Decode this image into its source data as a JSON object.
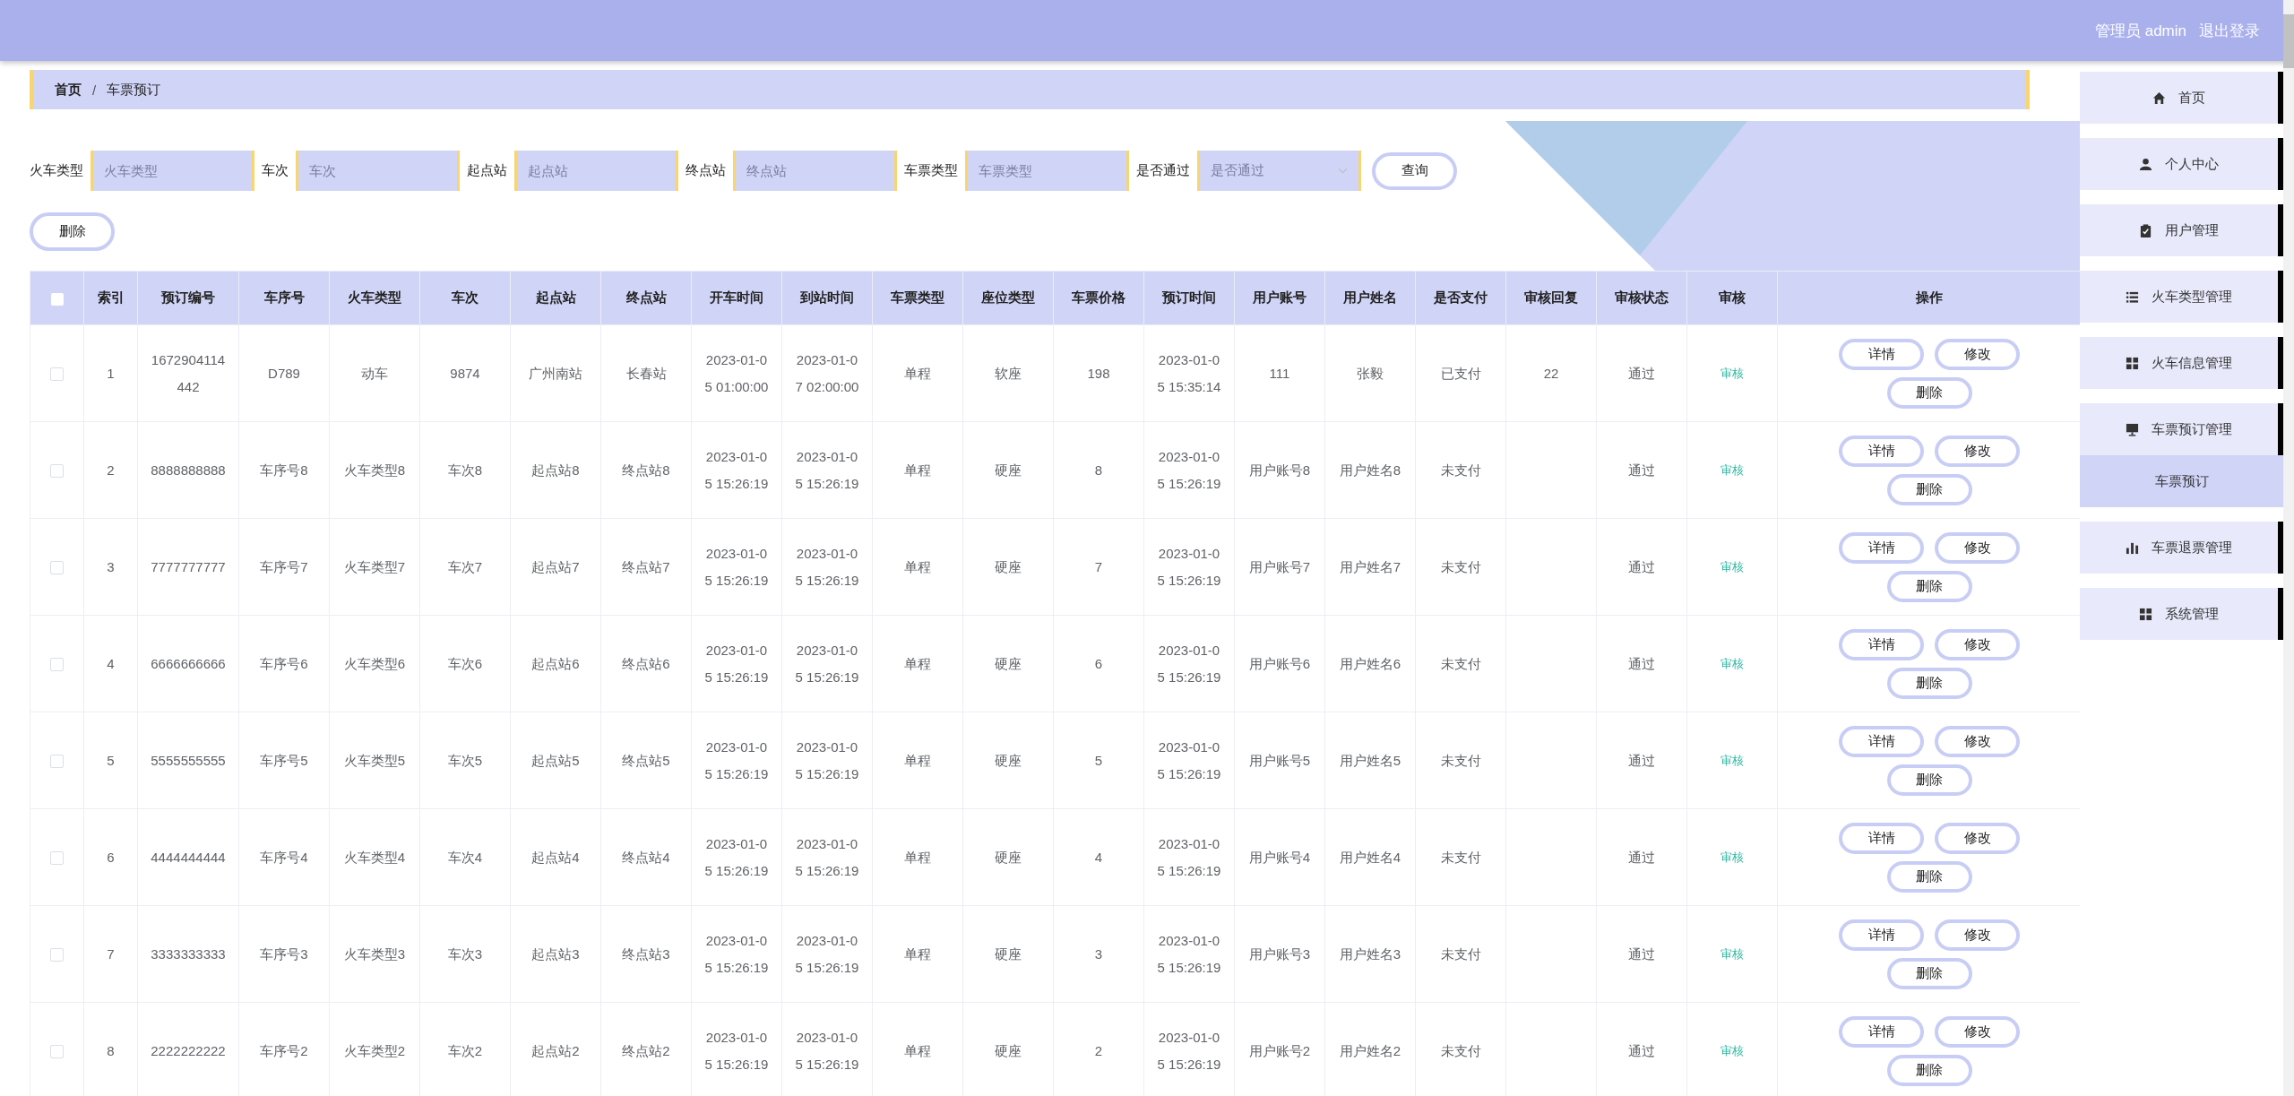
{
  "header": {
    "role": "管理员",
    "user": "admin",
    "logout": "退出登录"
  },
  "breadcrumb": [
    {
      "label": "首页",
      "current": false
    },
    {
      "separator": "/",
      "label": "车票预订",
      "current": true
    }
  ],
  "filters": [
    {
      "kind": "input",
      "label": "火车类型",
      "placeholder": "火车类型"
    },
    {
      "kind": "input",
      "label": "车次",
      "placeholder": "车次"
    },
    {
      "kind": "input",
      "label": "起点站",
      "placeholder": "起点站"
    },
    {
      "kind": "input",
      "label": "终点站",
      "placeholder": "终点站"
    },
    {
      "kind": "input",
      "label": "车票类型",
      "placeholder": "车票类型"
    },
    {
      "kind": "select",
      "label": "是否通过",
      "placeholder": "是否通过"
    }
  ],
  "search_button": "查询",
  "delete_button": "删除",
  "table": {
    "all_checked": false,
    "columns": [
      "索引",
      "预订编号",
      "车序号",
      "火车类型",
      "车次",
      "起点站",
      "终点站",
      "开车时间",
      "到站时间",
      "车票类型",
      "座位类型",
      "车票价格",
      "预订时间",
      "用户账号",
      "用户姓名",
      "是否支付",
      "审核回复",
      "审核状态",
      "审核",
      "操作"
    ],
    "rows": [
      {
        "checked": false,
        "cells": [
          "1",
          "1672904114442",
          "D789",
          "动车",
          "9874",
          "广州南站",
          "长春站",
          "2023-01-05 01:00:00",
          "2023-01-07 02:00:00",
          "单程",
          "软座",
          "198",
          "2023-01-05 15:35:14",
          "111",
          "张毅",
          "已支付",
          "22",
          "通过"
        ],
        "audit": "审核",
        "actions": [
          "详情",
          "修改",
          "删除"
        ]
      },
      {
        "checked": false,
        "cells": [
          "2",
          "8888888888",
          "车序号8",
          "火车类型8",
          "车次8",
          "起点站8",
          "终点站8",
          "2023-01-05 15:26:19",
          "2023-01-05 15:26:19",
          "单程",
          "硬座",
          "8",
          "2023-01-05 15:26:19",
          "用户账号8",
          "用户姓名8",
          "未支付",
          null,
          "通过"
        ],
        "audit": "审核",
        "actions": [
          "详情",
          "修改",
          "删除"
        ]
      },
      {
        "checked": false,
        "cells": [
          "3",
          "7777777777",
          "车序号7",
          "火车类型7",
          "车次7",
          "起点站7",
          "终点站7",
          "2023-01-05 15:26:19",
          "2023-01-05 15:26:19",
          "单程",
          "硬座",
          "7",
          "2023-01-05 15:26:19",
          "用户账号7",
          "用户姓名7",
          "未支付",
          null,
          "通过"
        ],
        "audit": "审核",
        "actions": [
          "详情",
          "修改",
          "删除"
        ]
      },
      {
        "checked": false,
        "cells": [
          "4",
          "6666666666",
          "车序号6",
          "火车类型6",
          "车次6",
          "起点站6",
          "终点站6",
          "2023-01-05 15:26:19",
          "2023-01-05 15:26:19",
          "单程",
          "硬座",
          "6",
          "2023-01-05 15:26:19",
          "用户账号6",
          "用户姓名6",
          "未支付",
          null,
          "通过"
        ],
        "audit": "审核",
        "actions": [
          "详情",
          "修改",
          "删除"
        ]
      },
      {
        "checked": false,
        "cells": [
          "5",
          "5555555555",
          "车序号5",
          "火车类型5",
          "车次5",
          "起点站5",
          "终点站5",
          "2023-01-05 15:26:19",
          "2023-01-05 15:26:19",
          "单程",
          "硬座",
          "5",
          "2023-01-05 15:26:19",
          "用户账号5",
          "用户姓名5",
          "未支付",
          null,
          "通过"
        ],
        "audit": "审核",
        "actions": [
          "详情",
          "修改",
          "删除"
        ]
      },
      {
        "checked": false,
        "cells": [
          "6",
          "4444444444",
          "车序号4",
          "火车类型4",
          "车次4",
          "起点站4",
          "终点站4",
          "2023-01-05 15:26:19",
          "2023-01-05 15:26:19",
          "单程",
          "硬座",
          "4",
          "2023-01-05 15:26:19",
          "用户账号4",
          "用户姓名4",
          "未支付",
          null,
          "通过"
        ],
        "audit": "审核",
        "actions": [
          "详情",
          "修改",
          "删除"
        ]
      },
      {
        "checked": false,
        "cells": [
          "7",
          "3333333333",
          "车序号3",
          "火车类型3",
          "车次3",
          "起点站3",
          "终点站3",
          "2023-01-05 15:26:19",
          "2023-01-05 15:26:19",
          "单程",
          "硬座",
          "3",
          "2023-01-05 15:26:19",
          "用户账号3",
          "用户姓名3",
          "未支付",
          null,
          "通过"
        ],
        "audit": "审核",
        "actions": [
          "详情",
          "修改",
          "删除"
        ]
      },
      {
        "checked": false,
        "cells": [
          "8",
          "2222222222",
          "车序号2",
          "火车类型2",
          "车次2",
          "起点站2",
          "终点站2",
          "2023-01-05 15:26:19",
          "2023-01-05 15:26:19",
          "单程",
          "硬座",
          "2",
          "2023-01-05 15:26:19",
          "用户账号2",
          "用户姓名2",
          "未支付",
          null,
          "通过"
        ],
        "audit": "审核",
        "actions": [
          "详情",
          "修改",
          "删除"
        ]
      }
    ]
  },
  "sidebar": {
    "items": [
      {
        "label": "首页"
      },
      {
        "label": "个人中心"
      },
      {
        "label": "用户管理"
      },
      {
        "label": "火车类型管理"
      },
      {
        "label": "火车信息管理"
      },
      {
        "label": "车票预订管理",
        "children": [
          {
            "label": "车票预订",
            "selected": true
          }
        ]
      },
      {
        "label": "车票退票管理"
      },
      {
        "label": "系统管理"
      }
    ]
  }
}
